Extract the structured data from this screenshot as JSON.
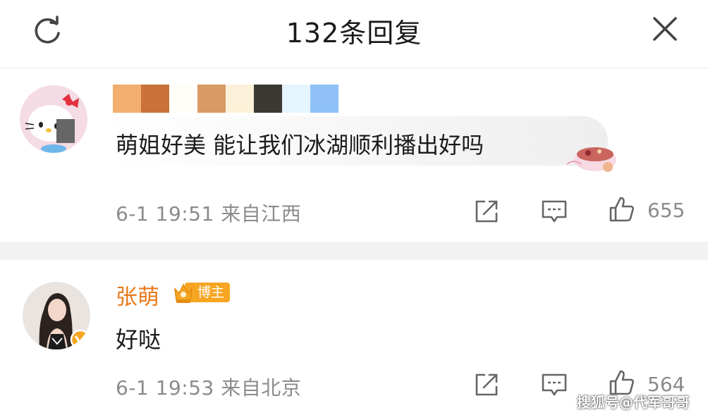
{
  "header": {
    "title": "132条回复",
    "icons": {
      "refresh": "refresh-icon",
      "close": "close-icon"
    }
  },
  "comments": [
    {
      "username_blocks": [
        "#f2ae6e",
        "#c9733a",
        "#fffdf8",
        "#d99a64",
        "#fdf1d9",
        "#3a3a33",
        "#e4f5ff",
        "#8fc0f7"
      ],
      "text": "萌姐好美 能让我们冰湖顺利播出好吗",
      "time": "6-1 19:51",
      "location": "来自江西",
      "likes": "655",
      "icons": [
        "share-icon",
        "comment-icon",
        "like-icon"
      ]
    },
    {
      "name": "张萌",
      "badge": "博主",
      "text": "好哒",
      "time": "6-1 19:53",
      "location": "来自北京",
      "likes": "564",
      "icons": [
        "share-icon",
        "comment-icon",
        "like-icon"
      ]
    }
  ],
  "colors": {
    "name_orange": "#e97a1c",
    "badge_gold": "#f6a623",
    "meta_gray": "#8b8b8b",
    "divider_gray": "#f2f2f2"
  },
  "watermark": "搜狐号@代军哥哥"
}
